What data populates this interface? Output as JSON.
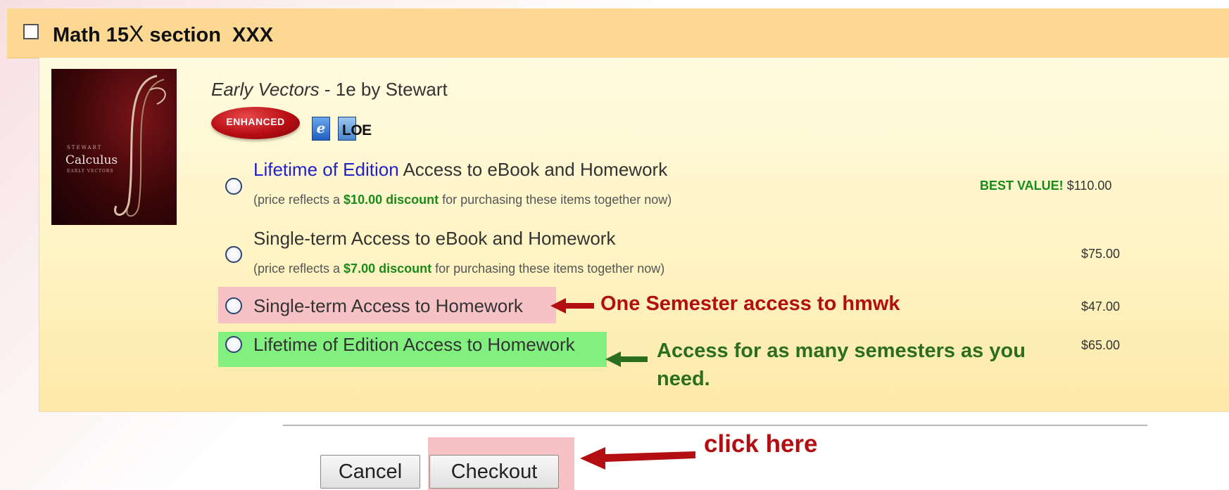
{
  "section": {
    "title": "Math 15",
    "title_mid": "X",
    "title_end": " section  XXX"
  },
  "book": {
    "name": "Early Vectors",
    "edition_author": " - 1e by Stewart",
    "cover": {
      "author": "STEWART",
      "title": "Calculus",
      "subtitle": "EARLY VECTORS"
    },
    "badges": {
      "enhanced": "ENHANCED",
      "ebook": "e",
      "loe": "LOE"
    }
  },
  "options": [
    {
      "label_highlight": "Lifetime of Edition",
      "label_rest": " Access to eBook and Homework",
      "note_pre": "(price reflects a ",
      "note_discount": "$10.00 discount",
      "note_post": " for purchasing these items together now)",
      "badge": "BEST VALUE!",
      "price": "$110.00"
    },
    {
      "label": "Single-term Access to eBook and Homework",
      "note_pre": "(price reflects a ",
      "note_discount": "$7.00 discount",
      "note_post": " for purchasing these items together now)",
      "price": "$75.00"
    },
    {
      "label": "Single-term Access to Homework",
      "price": "$47.00"
    },
    {
      "label": "Lifetime of Edition Access to Homework",
      "price": "$65.00"
    }
  ],
  "annotations": {
    "semester": "One Semester access to hmwk",
    "lifetime": "Access for as many semesters as you need.",
    "click": "click here"
  },
  "buttons": {
    "cancel": "Cancel",
    "checkout": "Checkout"
  },
  "colors": {
    "header_bg": "#fcd892",
    "panel_bg": "#fff3c2",
    "highlight_pink": "#f7c2c6",
    "highlight_green": "#82f07e",
    "annotation_red": "#b30e12",
    "annotation_green": "#2c6e20",
    "discount_green": "#1a8a1a",
    "link_blue": "#2222cc"
  }
}
